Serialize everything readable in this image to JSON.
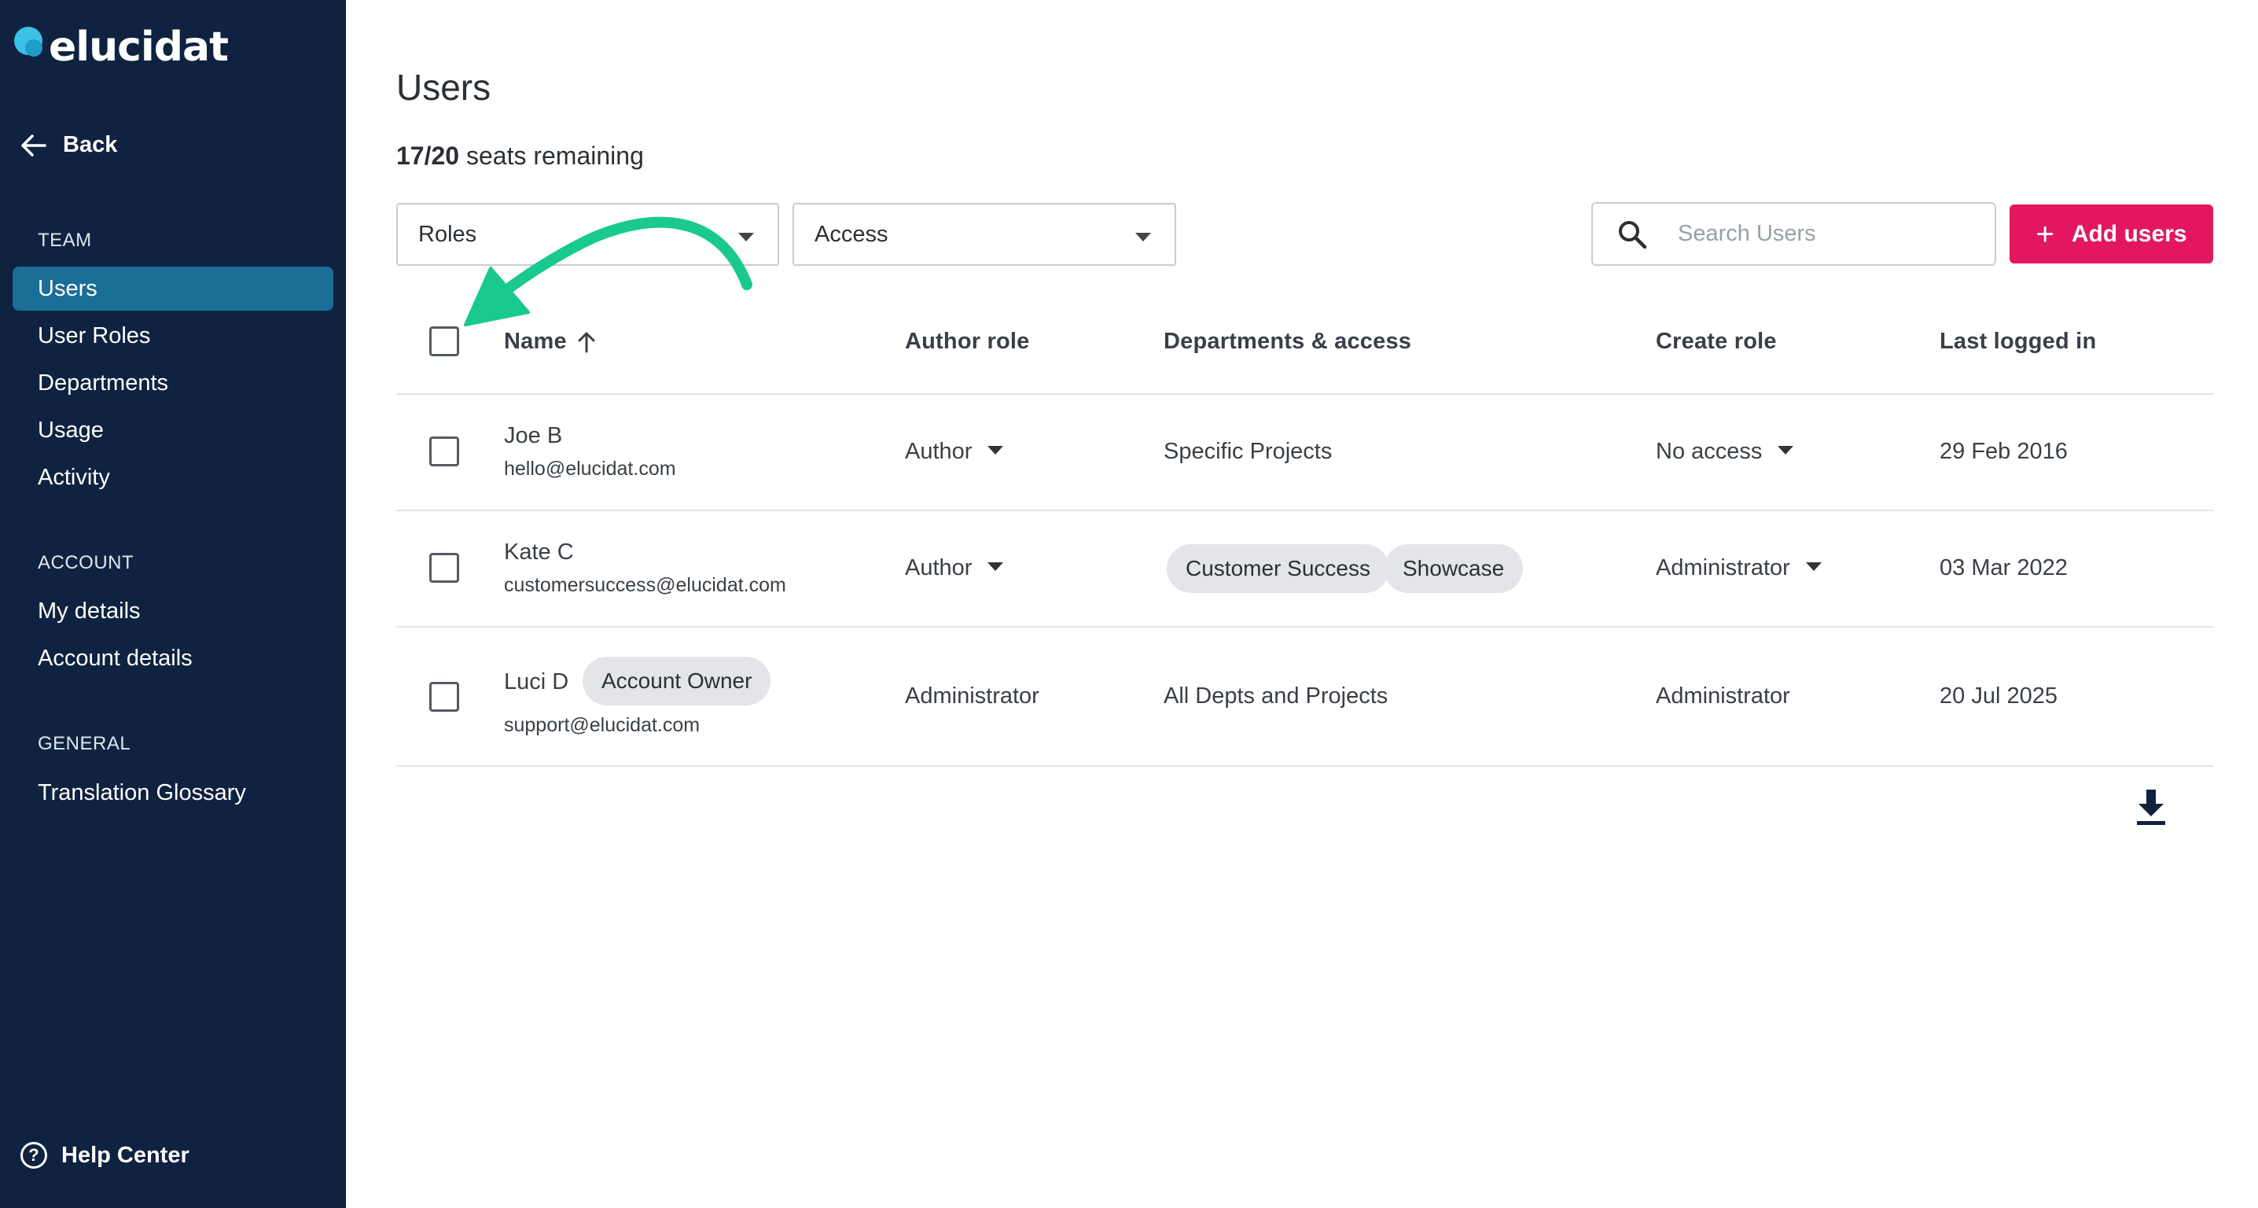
{
  "brand": {
    "logo_text": "elucidat"
  },
  "sidebar": {
    "back_label": "Back",
    "sections": [
      {
        "title": "TEAM",
        "items": [
          {
            "label": "Users",
            "active": true
          },
          {
            "label": "User Roles"
          },
          {
            "label": "Departments"
          },
          {
            "label": "Usage"
          },
          {
            "label": "Activity"
          }
        ]
      },
      {
        "title": "ACCOUNT",
        "items": [
          {
            "label": "My details"
          },
          {
            "label": "Account details"
          }
        ]
      },
      {
        "title": "GENERAL",
        "items": [
          {
            "label": "Translation Glossary"
          }
        ]
      }
    ],
    "help_label": "Help Center"
  },
  "main": {
    "title": "Users",
    "seats": {
      "count": "17/20",
      "suffix": " seats remaining"
    },
    "filters": {
      "roles": "Roles",
      "access": "Access"
    },
    "search": {
      "placeholder": "Search Users",
      "value": ""
    },
    "add_button": "Add users",
    "table": {
      "columns": [
        "Name",
        "Author role",
        "Departments & access",
        "Create role",
        "Last logged in"
      ],
      "sort": {
        "column": "Name",
        "direction": "ascending"
      },
      "rows": [
        {
          "name": "Joe B",
          "email": "hello@elucidat.com",
          "author_role": "Author",
          "departments": "Specific Projects",
          "create_role": "No access",
          "last_logged_in": "29 Feb 2016"
        },
        {
          "name": "Kate C",
          "email": "customersuccess@elucidat.com",
          "author_role": "Author",
          "departments_chips": [
            "Customer Success",
            "Showcase"
          ],
          "create_role": "Administrator",
          "last_logged_in": "03 Mar 2022"
        },
        {
          "name": "Luci D",
          "badge": "Account Owner",
          "email": "support@elucidat.com",
          "author_role": "Administrator",
          "departments": "All Depts and Projects",
          "create_role": "Administrator",
          "last_logged_in": "20 Jul 2025"
        }
      ]
    }
  },
  "colors": {
    "sidebar_bg": "#0f2340",
    "nav_active": "#1b6e96",
    "accent_pink": "#e2175f",
    "annotation_arrow": "#19c98f"
  },
  "icons": [
    "back-arrow-icon",
    "help-circle-icon",
    "search-icon",
    "plus-icon",
    "sort-up-arrow-icon",
    "caret-down-icon",
    "download-icon"
  ]
}
